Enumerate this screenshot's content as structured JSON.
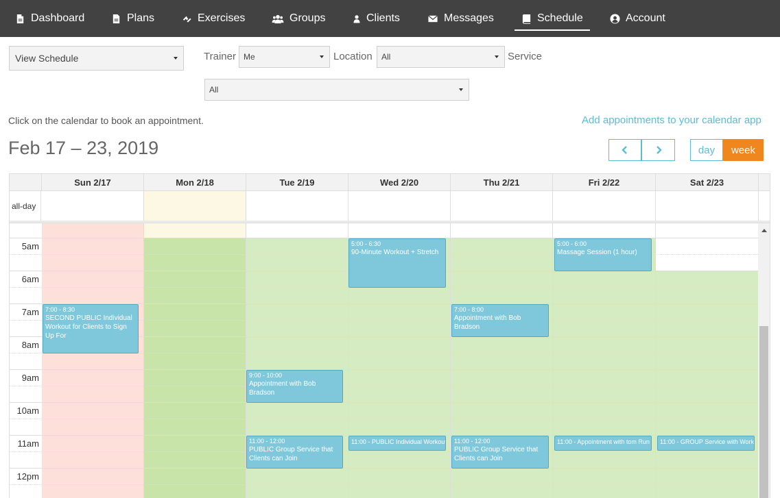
{
  "nav": {
    "items": [
      {
        "label": "Dashboard",
        "icon": "file-icon"
      },
      {
        "label": "Plans",
        "icon": "document-icon"
      },
      {
        "label": "Exercises",
        "icon": "dumbbell-icon"
      },
      {
        "label": "Groups",
        "icon": "users-icon"
      },
      {
        "label": "Clients",
        "icon": "user-icon"
      },
      {
        "label": "Messages",
        "icon": "envelope-icon"
      },
      {
        "label": "Schedule",
        "icon": "book-icon",
        "active": true
      },
      {
        "label": "Account",
        "icon": "account-circle-icon"
      }
    ]
  },
  "filters": {
    "view": "View Schedule",
    "trainer_label": "Trainer",
    "trainer_value": "Me",
    "location_label": "Location",
    "location_value": "All",
    "service_label": "Service",
    "service_value": "All"
  },
  "info": {
    "instruction": "Click on the calendar to book an appointment.",
    "calendar_link": "Add appointments to your calendar app"
  },
  "calendar": {
    "title": "Feb 17 – 23, 2019",
    "view_day": "day",
    "view_week": "week",
    "allday_label": "all-day",
    "days": [
      "Sun 2/17",
      "Mon 2/18",
      "Tue 2/19",
      "Wed 2/20",
      "Thu 2/21",
      "Fri 2/22",
      "Sat 2/23"
    ],
    "times": [
      "5am",
      "6am",
      "7am",
      "8am",
      "9am",
      "10am",
      "11am",
      "12pm"
    ],
    "events": [
      {
        "day": 0,
        "time": "7:00 - 8:30",
        "title": "SECOND PUBLIC Individual Workout for Clients to Sign Up For"
      },
      {
        "day": 3,
        "time": "5:00 - 6:30",
        "title": "90-Minute Workout + Stretch"
      },
      {
        "day": 5,
        "time": "5:00 - 6:00",
        "title": "Massage Session (1 hour)"
      },
      {
        "day": 4,
        "time": "7:00 - 8:00",
        "title": "Appointment with Bob Bradson"
      },
      {
        "day": 2,
        "time": "9:00 - 10:00",
        "title": "Appointment with Bob Bradson"
      },
      {
        "day": 2,
        "time": "11:00 - 12:00",
        "title": "PUBLIC Group Service that Clients can Join"
      },
      {
        "day": 3,
        "time": "11:00",
        "title": "PUBLIC Individual Workout"
      },
      {
        "day": 4,
        "time": "11:00 - 12:00",
        "title": "PUBLIC Group Service that Clients can Join"
      },
      {
        "day": 5,
        "time": "11:00",
        "title": "Appointment with tom Run"
      },
      {
        "day": 6,
        "time": "11:00",
        "title": "GROUP Service with Work"
      }
    ]
  },
  "colors": {
    "nav_bg": "#424242",
    "accent": "#5bbcd5",
    "week_active": "#f0861e",
    "event": "#7fc8dc",
    "available": "#d5ecc2",
    "available_today": "#c9e4a8",
    "unavailable": "#fde0da",
    "today_allday": "#fcf8e3"
  }
}
